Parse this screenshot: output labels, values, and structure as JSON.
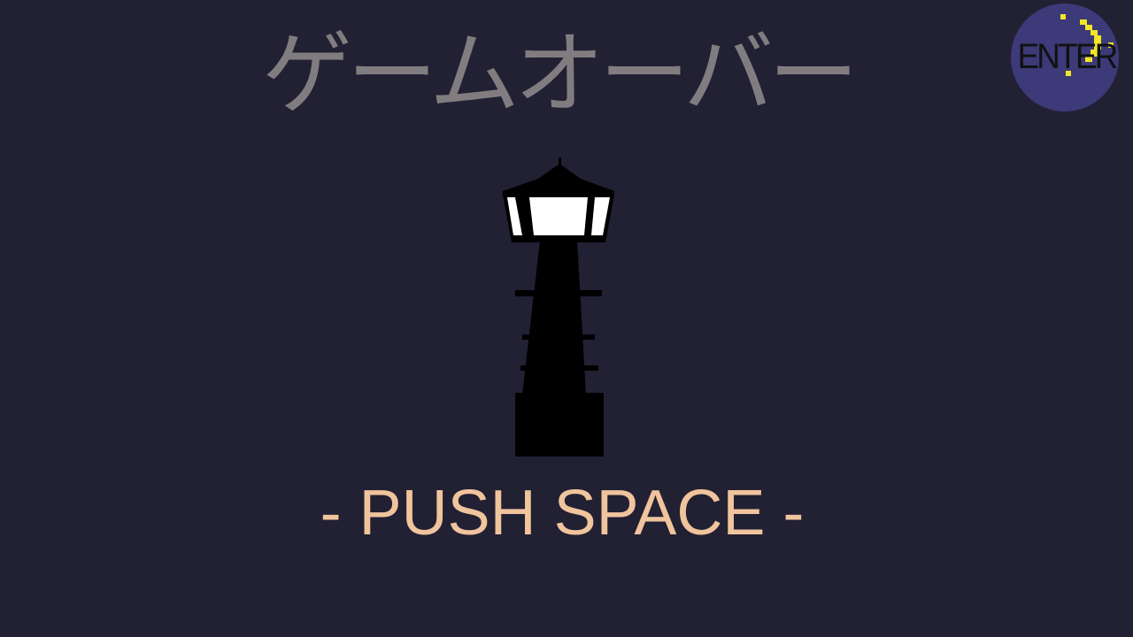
{
  "screen": {
    "title": "ゲームオーバー",
    "prompt": "- PUSH SPACE -",
    "enter_button": {
      "label": "ENTER",
      "icon": "moon-icon"
    }
  },
  "colors": {
    "background": "#222033",
    "title": "#807c80",
    "prompt": "#f0c49c",
    "enter_circle": "#3c3a78",
    "enter_text": "#111111",
    "moon": "#f2e626",
    "lighthouse_body": "#000000",
    "lighthouse_lamp": "#ffffff"
  }
}
